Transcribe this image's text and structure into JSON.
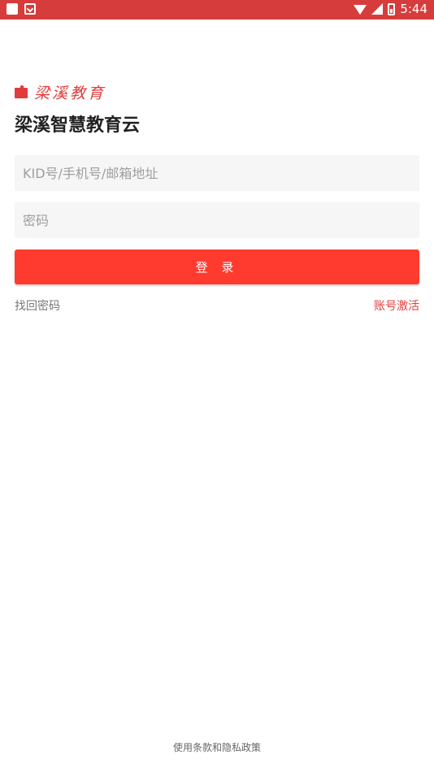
{
  "status_bar": {
    "time": "5:44",
    "background": "#d73c3c"
  },
  "brand": {
    "logo_text": "梁溪教育",
    "title": "梁溪智慧教育云",
    "accent_color": "#ff3b30"
  },
  "form": {
    "account_placeholder": "KID号/手机号/邮箱地址",
    "password_placeholder": "密码",
    "login_label": "登 录"
  },
  "links": {
    "forgot_password": "找回密码",
    "activate_account": "账号激活"
  },
  "footer": {
    "terms": "使用条款和隐私政策"
  },
  "icons": [
    "square-icon",
    "mail-icon",
    "wifi-icon",
    "signal-icon",
    "battery-icon",
    "logo-icon"
  ]
}
